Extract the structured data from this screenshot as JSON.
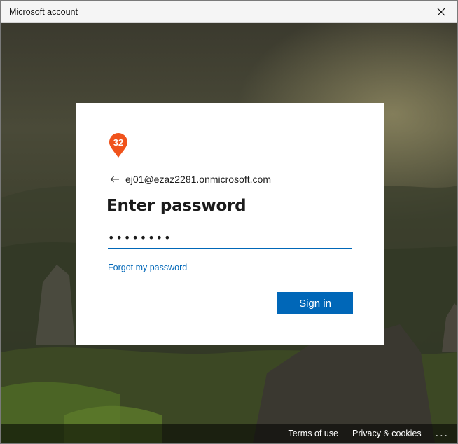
{
  "window": {
    "title": "Microsoft account"
  },
  "logo": {
    "badge_text": "32",
    "color": "#f0531c"
  },
  "card": {
    "email": "ej01@ezaz2281.onmicrosoft.com",
    "heading": "Enter password",
    "password_value": "••••••••",
    "forgot_label": "Forgot my password",
    "signin_label": "Sign in"
  },
  "footer": {
    "terms_label": "Terms of use",
    "privacy_label": "Privacy & cookies",
    "more_label": "..."
  },
  "colors": {
    "accent": "#0067b8",
    "card_bg": "#ffffff"
  }
}
